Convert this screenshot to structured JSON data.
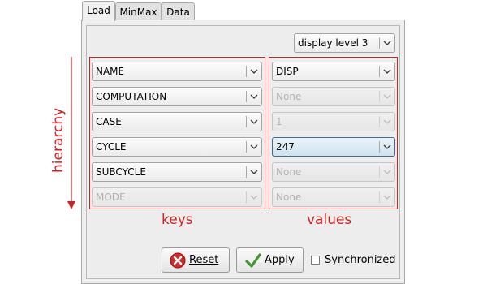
{
  "tabs": [
    {
      "label": "Load"
    },
    {
      "label": "MinMax"
    },
    {
      "label": "Data"
    }
  ],
  "display_level": {
    "value": "display level 3"
  },
  "keys": [
    {
      "value": "NAME",
      "enabled": true
    },
    {
      "value": "COMPUTATION",
      "enabled": true
    },
    {
      "value": "CASE",
      "enabled": true
    },
    {
      "value": "CYCLE",
      "enabled": true
    },
    {
      "value": "SUBCYCLE",
      "enabled": true
    },
    {
      "value": "MODE",
      "enabled": false
    }
  ],
  "values": [
    {
      "value": "DISP",
      "enabled": true
    },
    {
      "value": "None",
      "enabled": false
    },
    {
      "value": "1",
      "enabled": false
    },
    {
      "value": "247",
      "enabled": true,
      "selected": true
    },
    {
      "value": "None",
      "enabled": false
    },
    {
      "value": "None",
      "enabled": false
    }
  ],
  "annotations": {
    "hierarchy": "hierarchy",
    "keys": "keys",
    "values": "values",
    "color": "#cc2222"
  },
  "buttons": {
    "reset": "Reset",
    "apply": "Apply",
    "synchronized": "Synchronized"
  },
  "synchronized_checked": false
}
